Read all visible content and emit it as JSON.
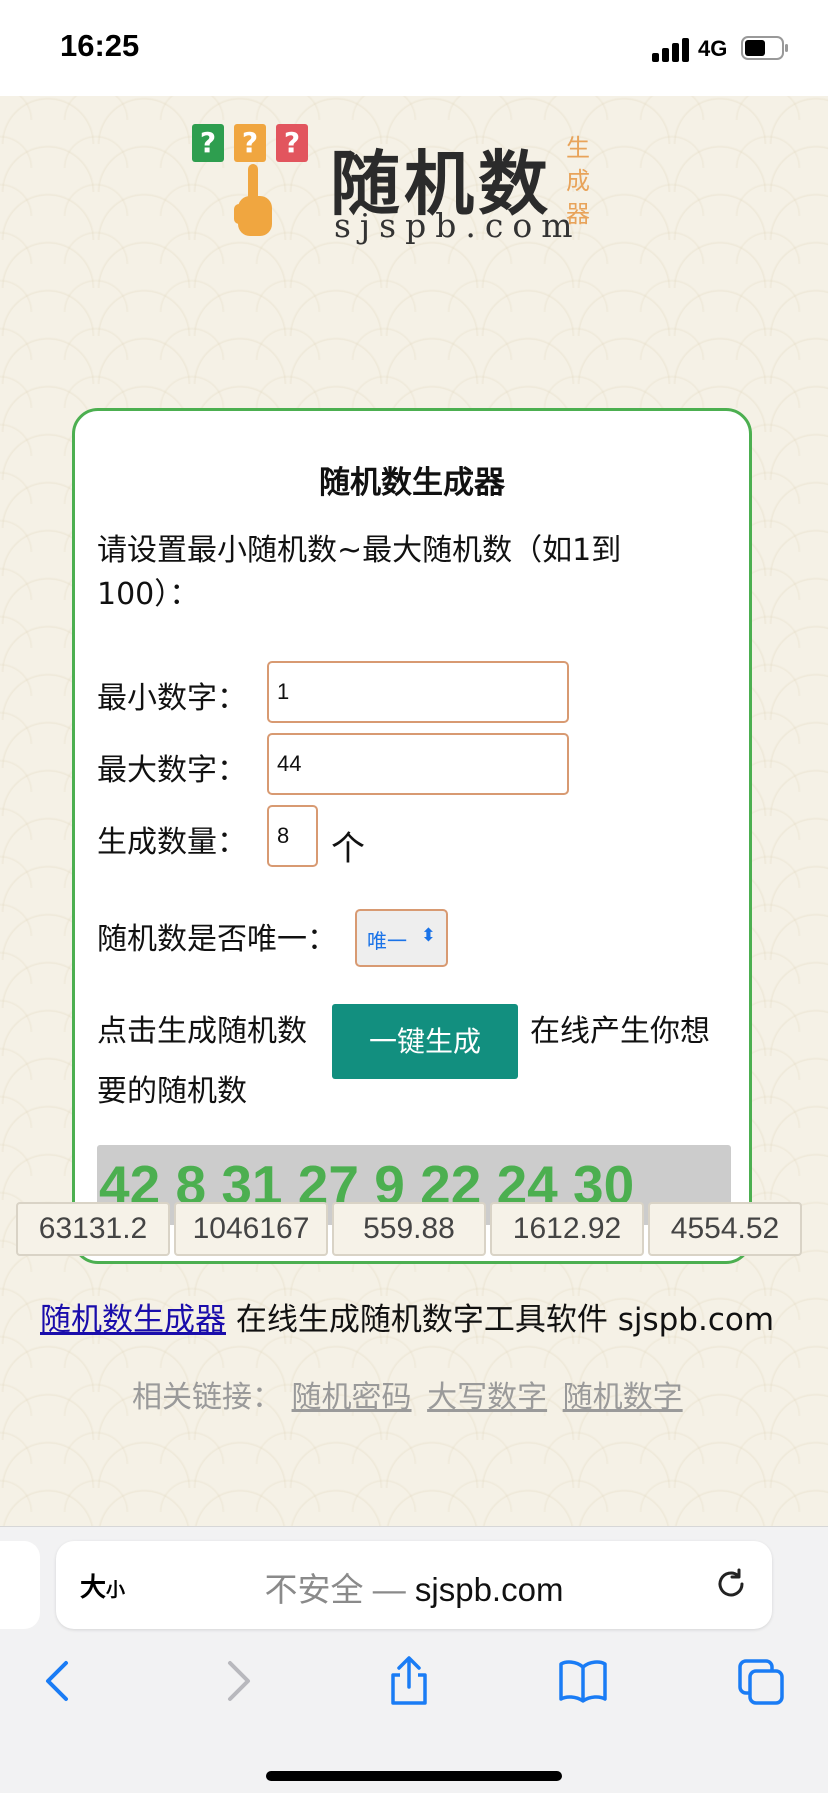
{
  "status_bar": {
    "time": "16:25",
    "network": "4G",
    "icons": [
      "signal-icon",
      "battery-icon"
    ]
  },
  "logo": {
    "marks": [
      "?",
      "?",
      "?"
    ],
    "title": "随机数",
    "subtitle": "sjspb.com",
    "side_text": "生成器",
    "colors": {
      "q1": "#2e9e4f",
      "q2": "#f0a640",
      "q3": "#e2555e",
      "hand": "#f0a640"
    }
  },
  "card": {
    "title": "随机数生成器",
    "instruction": "请设置最小随机数~最大随机数（如1到100）：",
    "min_label": "最小数字：",
    "min_value": "1",
    "max_label": "最大数字：",
    "max_value": "44",
    "count_label": "生成数量：",
    "count_value": "8",
    "count_unit": "个",
    "unique_label": "随机数是否唯一：",
    "unique_value": "唯一",
    "gen_prefix": "点击生成随机数",
    "gen_button": "一键生成",
    "gen_suffix": "在线产生你想",
    "gen_suffix2": "要的随机数",
    "result": "42 8 31 27 9 22 24 30",
    "colors": {
      "border": "#4caf50",
      "button": "#128f7f",
      "result_text": "#4caf50",
      "result_bg": "#cccccc"
    }
  },
  "chips": [
    "63131.2",
    "1046167",
    "559.88",
    "1612.92",
    "4554.52"
  ],
  "footer": {
    "link": "随机数生成器",
    "text": "在线生成随机数字工具软件 sjspb.com"
  },
  "related": {
    "label": "相关链接：",
    "links": [
      "随机密码",
      "大写数字",
      "随机数字"
    ]
  },
  "browser": {
    "text_size": "大",
    "text_size_small": "小",
    "insecure": "不安全 — ",
    "domain": "sjspb.com",
    "toolbar": [
      "back-icon",
      "forward-icon",
      "share-icon",
      "bookmarks-icon",
      "tabs-icon"
    ]
  }
}
